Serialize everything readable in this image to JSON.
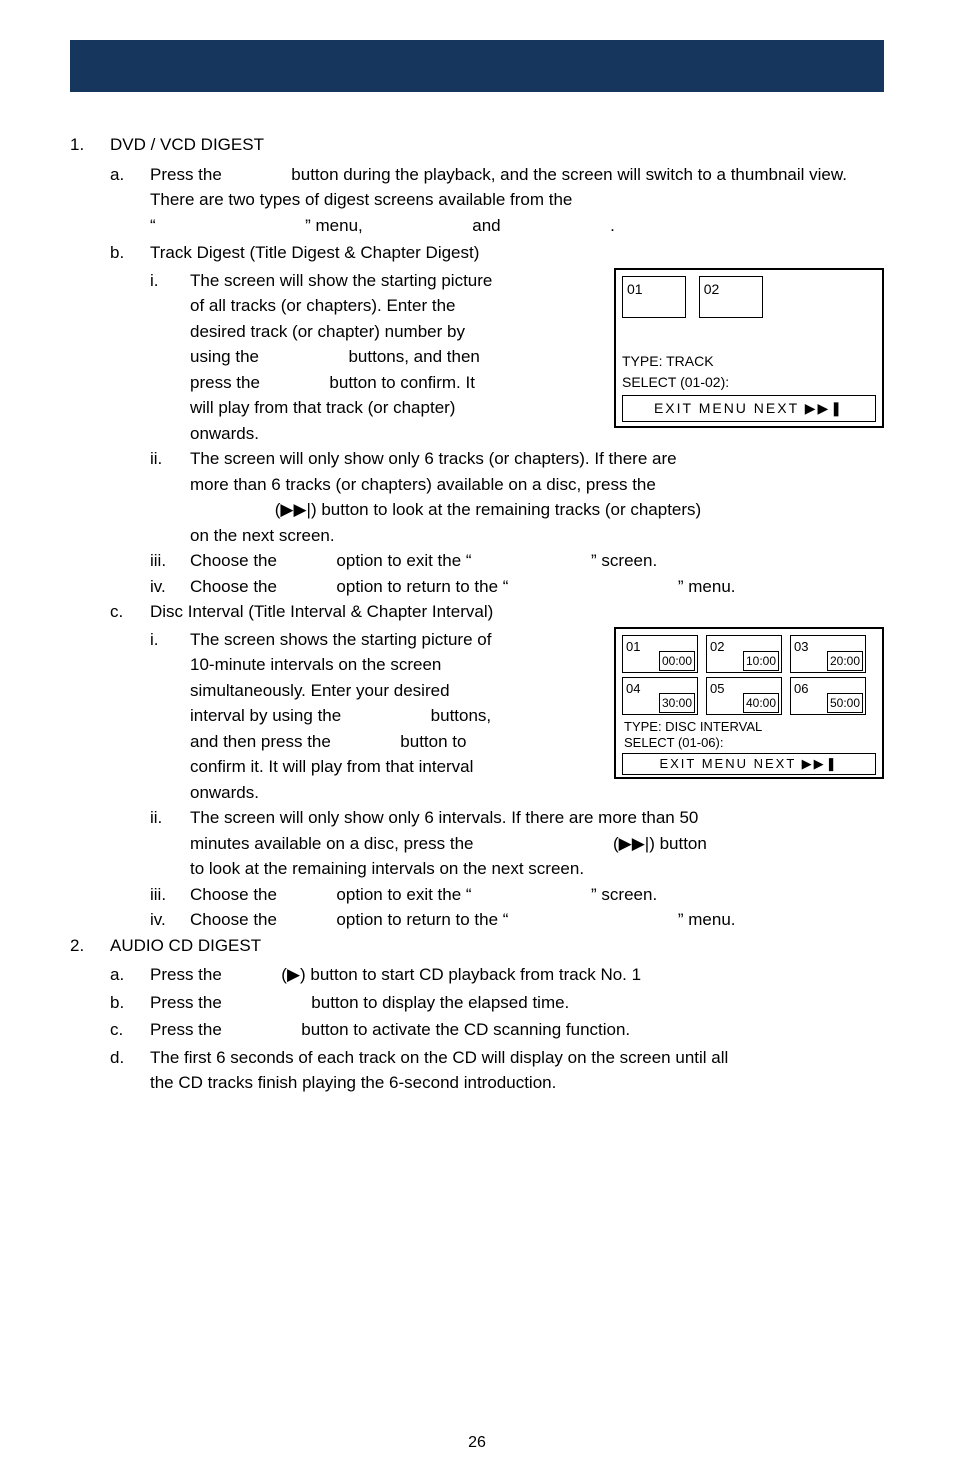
{
  "section1": {
    "num": "1.",
    "title": "DVD / VCD DIGEST",
    "a": {
      "letter": "a.",
      "text_pre": "Press the",
      "text_mid": "button during the playback, and the screen will switch to a thumbnail view. There are two types of digest screens available from the",
      "open_quote": "“",
      "close_quote": "” menu,",
      "and_word": "and",
      "period": "."
    },
    "b": {
      "letter": "b.",
      "title": "Track Digest (Title Digest & Chapter Digest)",
      "i": {
        "num": "i.",
        "l1": "The screen will show the starting picture",
        "l2": "of all tracks (or chapters). Enter the",
        "l3": "desired track (or chapter) number by",
        "l4a": "using the",
        "l4b": "buttons, and then",
        "l5a": "press the",
        "l5b": "button to confirm. It",
        "l6": "will play from that track (or chapter)",
        "l7": "onwards."
      },
      "ii": {
        "num": "ii.",
        "l1": "The screen will only show only 6 tracks (or chapters). If there are",
        "l2": "more than 6 tracks (or chapters) available on a disc, press the",
        "l3": "(▶▶|) button to look at the remaining tracks (or chapters)",
        "l4": "on the next screen."
      },
      "iii": {
        "num": "iii.",
        "pre": "Choose the",
        "mid": "option to exit the “",
        "post": "” screen."
      },
      "iv": {
        "num": "iv.",
        "pre": "Choose the",
        "mid": "option to return to the “",
        "post": "” menu."
      }
    },
    "c": {
      "letter": "c.",
      "title": "Disc Interval (Title Interval & Chapter Interval)",
      "i": {
        "num": "i.",
        "l1": "The screen shows the starting picture of",
        "l2": "10-minute intervals on the screen",
        "l3": "simultaneously. Enter your desired",
        "l4a": "interval by using the",
        "l4b": "buttons,",
        "l5a": "and then press the",
        "l5b": "button to",
        "l6": "confirm it. It will play from that interval",
        "l7": "onwards."
      },
      "ii": {
        "num": "ii.",
        "l1": "The screen will only show only 6 intervals. If there are more than 50",
        "l2a": "minutes available on a disc, press the",
        "l2b": "(▶▶|) button",
        "l3": "to look at the remaining intervals on the next screen."
      },
      "iii": {
        "num": "iii.",
        "pre": "Choose the",
        "mid": "option to exit the “",
        "post": "” screen."
      },
      "iv": {
        "num": "iv.",
        "pre": "Choose the",
        "mid": "option to return to the “",
        "post": "” menu."
      }
    }
  },
  "section2": {
    "num": "2.",
    "title": "AUDIO CD DIGEST",
    "a": {
      "letter": "a.",
      "pre": "Press the",
      "btn": "(▶) button to start CD playback from track No. 1"
    },
    "b": {
      "letter": "b.",
      "pre": "Press the",
      "post": "button to display the elapsed time."
    },
    "c": {
      "letter": "c.",
      "pre": "Press the",
      "post": "button to activate the CD scanning function."
    },
    "d": {
      "letter": "d.",
      "l1": "The first 6 seconds of each track on the CD will display on the screen until all",
      "l2": "the CD tracks finish playing the 6-second introduction."
    }
  },
  "figTrack": {
    "cell01": "01",
    "cell02": "02",
    "type": "TYPE: TRACK",
    "select": "SELECT (01-02):",
    "menu": "EXIT  MENU  NEXT ▶▶❚"
  },
  "figInterval": {
    "cells": [
      {
        "n": "01",
        "t": "00:00"
      },
      {
        "n": "02",
        "t": "10:00"
      },
      {
        "n": "03",
        "t": "20:00"
      },
      {
        "n": "04",
        "t": "30:00"
      },
      {
        "n": "05",
        "t": "40:00"
      },
      {
        "n": "06",
        "t": "50:00"
      }
    ],
    "type": "TYPE: DISC INTERVAL",
    "select": "SELECT (01-06):",
    "menu": "EXIT  MENU  NEXT ▶▶❚"
  },
  "pageNumber": "26"
}
